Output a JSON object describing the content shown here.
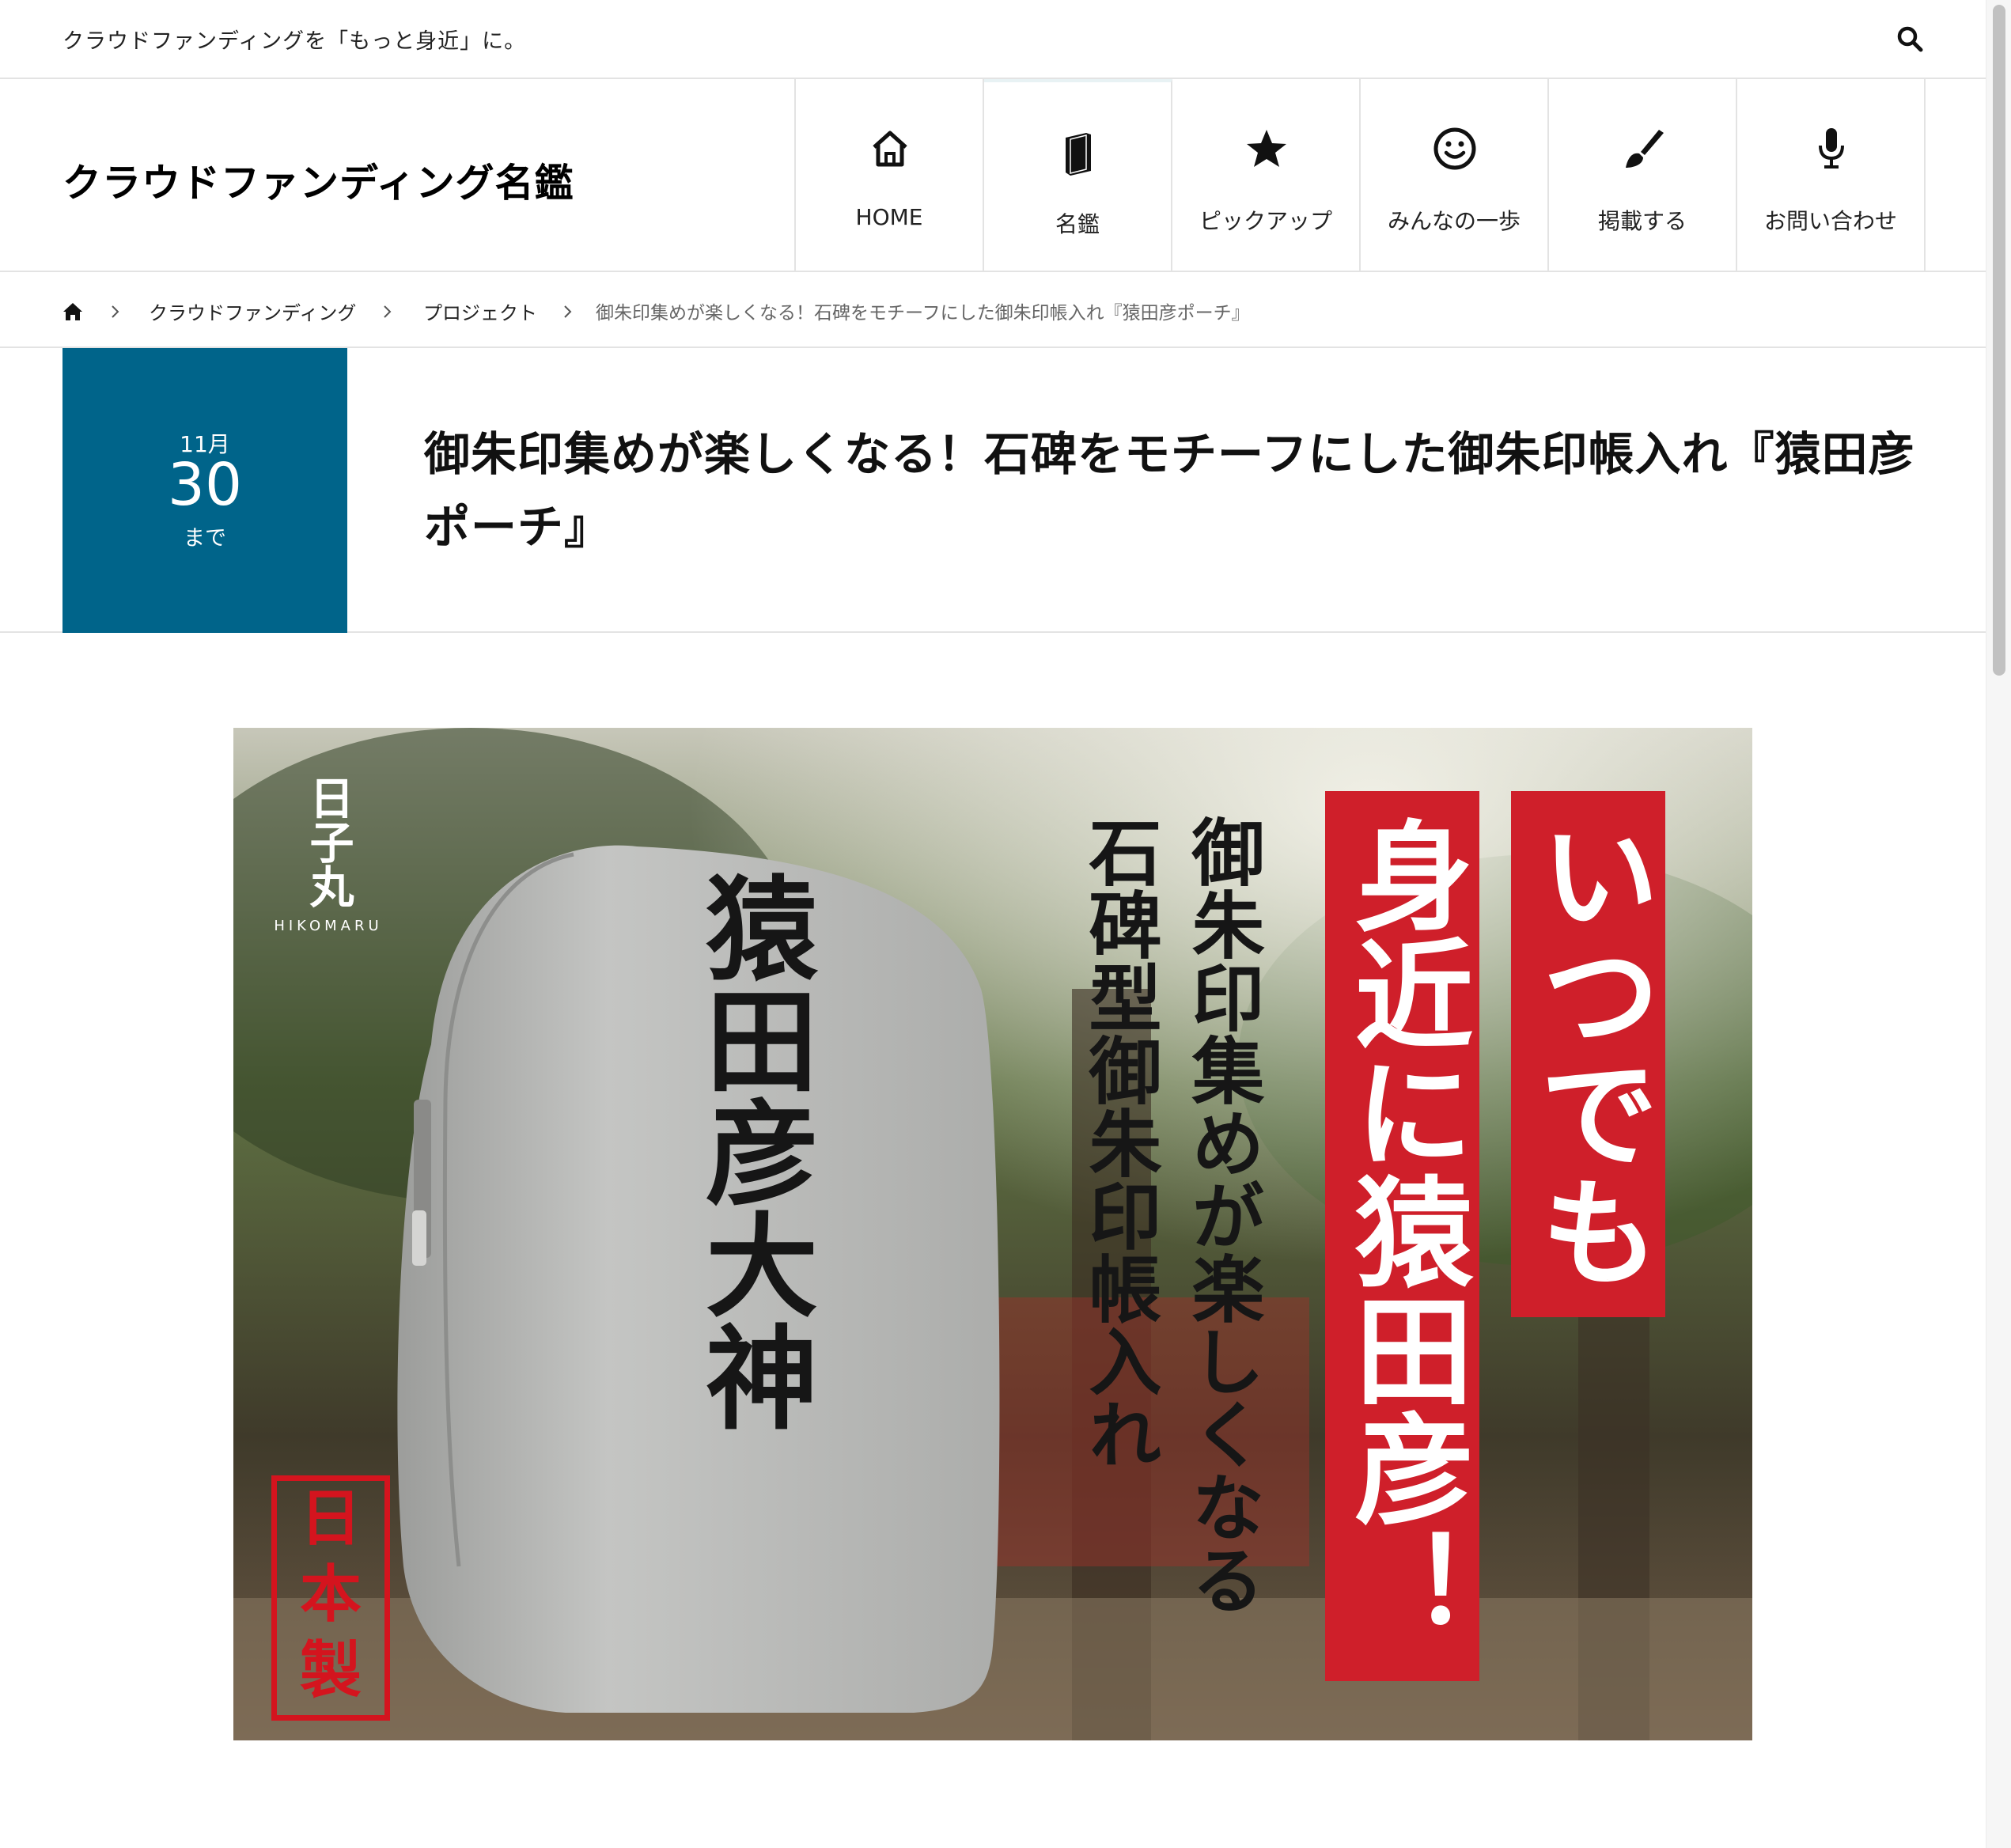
{
  "topbar": {
    "tagline": "クラウドファンディングを「もっと身近」に。",
    "search_icon": "search-icon"
  },
  "header": {
    "logo": "クラウドファンディング名鑑",
    "nav": [
      {
        "label": "HOME",
        "icon": "home-icon"
      },
      {
        "label": "名鑑",
        "icon": "book-icon"
      },
      {
        "label": "ピックアップ",
        "icon": "star-icon"
      },
      {
        "label": "みんなの一歩",
        "icon": "smile-icon"
      },
      {
        "label": "掲載する",
        "icon": "brush-icon"
      },
      {
        "label": "お問い合わせ",
        "icon": "microphone-icon"
      }
    ],
    "active_nav_index": 1
  },
  "breadcrumb": {
    "home_icon": "home-icon",
    "items": [
      "クラウドファンディング",
      "プロジェクト"
    ],
    "current": "御朱印集めが楽しくなる！石碑をモチーフにした御朱印帳入れ『猿田彦ポーチ』"
  },
  "post": {
    "date_month": "11月",
    "date_day": "30",
    "date_suffix": "まで",
    "title": "御朱印集めが楽しくなる！石碑をモチーフにした御朱印帳入れ『猿田彦ポーチ』",
    "accent_color": "#00648a"
  },
  "hero": {
    "brand_kanji": "日子丸",
    "brand_roman": "HIKOMARU",
    "pouch_text": "猿田彦大神",
    "stamp_text": [
      "日",
      "本",
      "製"
    ],
    "banner_line1": "いつでも",
    "banner_line2": "身近に猿田彦！",
    "caption_line1": "御朱印集めが楽しくなる",
    "caption_line2": "石碑型御朱印帳入れ",
    "banner_color": "#cf1f2a"
  }
}
